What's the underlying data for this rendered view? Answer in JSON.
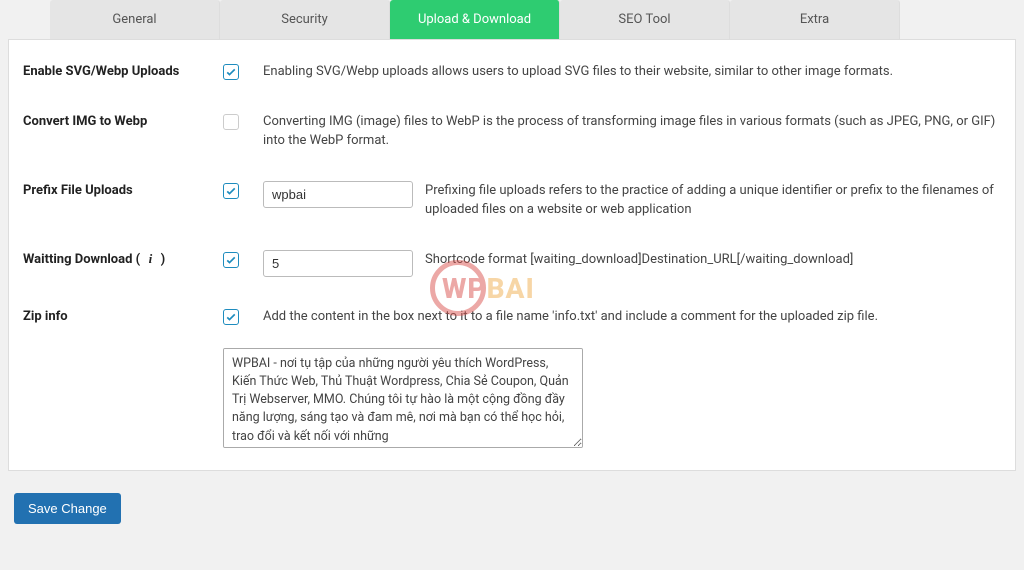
{
  "tabs": {
    "general": "General",
    "security": "Security",
    "upload_download": "Upload & Download",
    "seo_tool": "SEO Tool",
    "extra": "Extra"
  },
  "rows": {
    "svg": {
      "label": "Enable SVG/Webp Uploads",
      "desc": "Enabling SVG/Webp uploads allows users to upload SVG files to their website, similar to other image formats."
    },
    "convert": {
      "label": "Convert IMG to Webp",
      "desc": "Converting IMG (image) files to WebP is the process of transforming image files in various formats (such as JPEG, PNG, or GIF) into the WebP format."
    },
    "prefix": {
      "label": "Prefix File Uploads",
      "value": "wpbai",
      "desc": "Prefixing file uploads refers to the practice of adding a unique identifier or prefix to the filenames of uploaded files on a website or web application"
    },
    "waiting": {
      "label": "Waitting Download ( ",
      "label_close": " )",
      "value": "5",
      "desc": "Shortcode format [waiting_download]Destination_URL[/waiting_download]"
    },
    "zip": {
      "label": "Zip info",
      "desc": "Add the content in the box next to it to a file name 'info.txt' and include a comment for the uploaded zip file.",
      "textarea": "WPBAI - nơi tụ tập của những người yêu thích WordPress, Kiến Thức Web, Thủ Thuật Wordpress, Chia Sẻ Coupon, Quản Trị Webserver, MMO. Chúng tôi tự hào là một cộng đồng đầy năng lượng, sáng tạo và đam mê, nơi mà bạn có thể học hỏi, trao đổi và kết nối với những"
    }
  },
  "watermark": {
    "wp": "WP",
    "bai": "BAI"
  },
  "save": "Save Change",
  "info_glyph": "i"
}
